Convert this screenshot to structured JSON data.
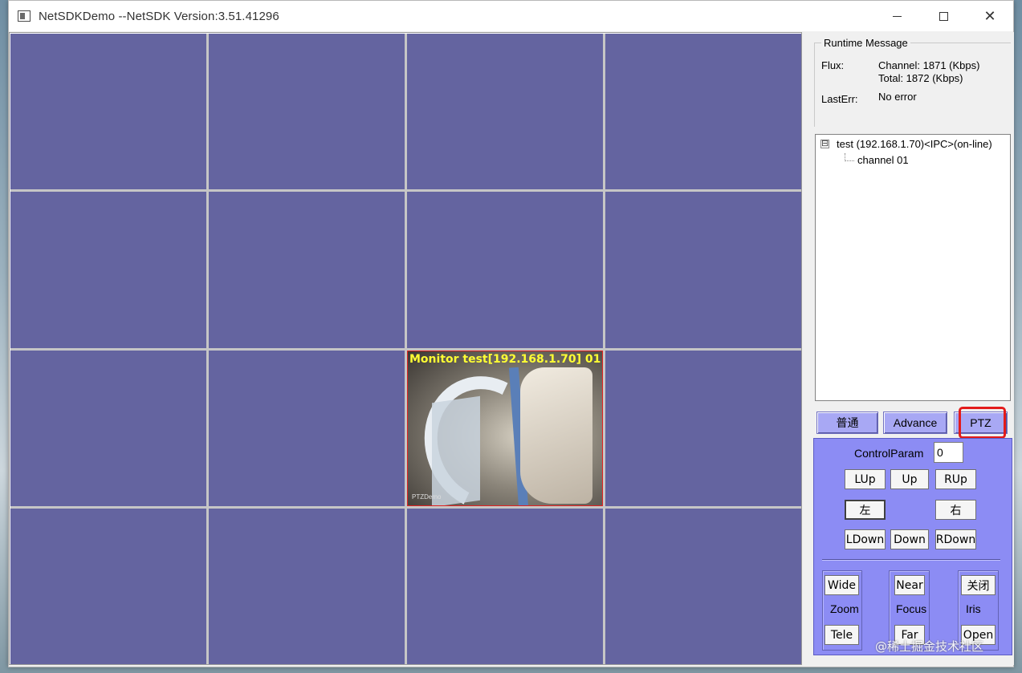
{
  "window": {
    "title": "NetSDKDemo  --NetSDK Version:3.51.41296",
    "icon": "app-window-icon",
    "controls": {
      "minimize": "—",
      "maximize": "☐",
      "close": "✕"
    }
  },
  "video": {
    "active_overlay": "Monitor test[192.168.1.70] 01",
    "watermark_text": "PTZDemo"
  },
  "runtime": {
    "legend": "Runtime Message",
    "flux_label": "Flux:",
    "channel_flux": "Channel: 1871 (Kbps)",
    "total_flux": "Total: 1872 (Kbps)",
    "lasterr_label": "LastErr:",
    "lasterr_value": "No error"
  },
  "tree": {
    "toggle": "⊟",
    "device": "test (192.168.1.70)<IPC>(on-line)",
    "channel": "channel 01"
  },
  "tabs": {
    "normal": "普通",
    "advance": "Advance",
    "ptz": "PTZ"
  },
  "ptz": {
    "control_param_label": "ControlParam",
    "control_param_value": "0",
    "lup": "LUp",
    "up": "Up",
    "rup": "RUp",
    "left": "左",
    "right": "右",
    "ldown": "LDown",
    "down": "Down",
    "rdown": "RDown",
    "wide": "Wide",
    "zoom": "Zoom",
    "tele": "Tele",
    "near": "Near",
    "focus": "Focus",
    "far": "Far",
    "iris_close": "关闭",
    "iris": "Iris",
    "iris_open": "Open"
  },
  "page_watermark": "@稀土掘金技术社区"
}
